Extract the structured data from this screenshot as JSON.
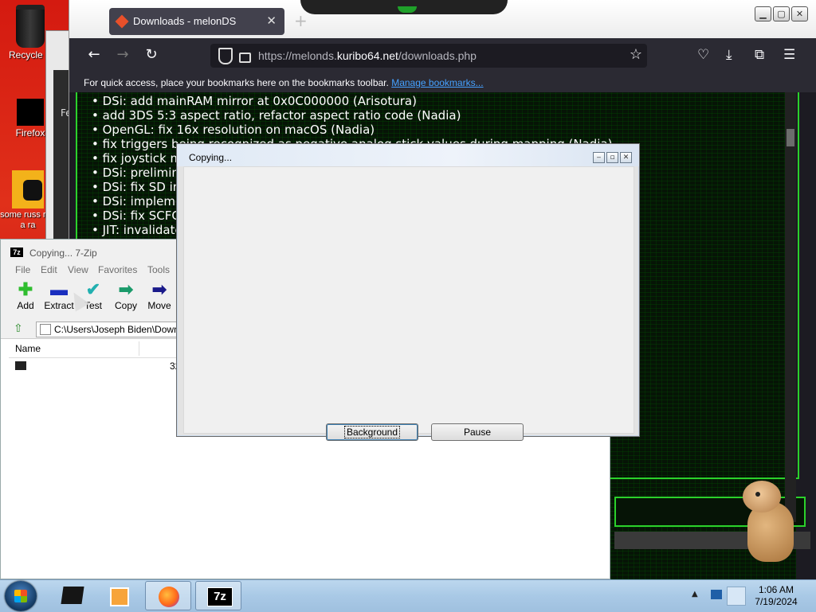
{
  "desktop": {
    "icons": [
      {
        "label": "Recycle B"
      },
      {
        "label": "Firefox"
      },
      {
        "label": "some russ ran a ra"
      }
    ],
    "behind_window_label": "Fe"
  },
  "firefox": {
    "tab_title": "Downloads - melonDS",
    "url_prefix": "https://melonds.",
    "url_domain": "kuribo64.net",
    "url_path": "/downloads.php",
    "bookmarks_text": "For quick access, place your bookmarks here on the bookmarks toolbar.",
    "bookmarks_link": "Manage bookmarks...",
    "changelog": [
      "DSi: add mainRAM mirror at 0x0C000000 (Arisotura)",
      "add 3DS 5:3 aspect ratio, refactor aspect ratio code (Nadia)",
      "OpenGL: fix 16x resolution on macOS (Nadia)",
      "fix triggers being recognized as negative analog stick values during mapping (Nadia)",
      "fix joystick m",
      "DSi: prelimina",
      "DSi: fix SD in",
      "DSi: impleme",
      "DSi: fix SCFG",
      "JIT: invalidate"
    ]
  },
  "zip_fm": {
    "title": "Copying... 7-Zip",
    "menu": [
      "File",
      "Edit",
      "View",
      "Favorites",
      "Tools"
    ],
    "toolbar": [
      {
        "label": "Add",
        "icon": "plus-icon"
      },
      {
        "label": "Extract",
        "icon": "minus-icon"
      },
      {
        "label": "Test",
        "icon": "check-icon"
      },
      {
        "label": "Copy",
        "icon": "copy-arrow-icon"
      },
      {
        "label": "Move",
        "icon": "move-arrow-icon"
      }
    ],
    "address": "C:\\Users\\Joseph Biden\\Down",
    "column_name": "Name",
    "row_size": "32"
  },
  "copy_dialog": {
    "title": "Copying...",
    "background_button": "Background",
    "pause_button": "Pause"
  },
  "taskbar": {
    "time": "1:06 AM",
    "date": "7/19/2024"
  }
}
